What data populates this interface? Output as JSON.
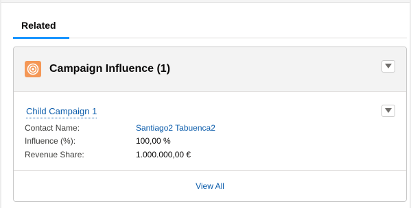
{
  "tabs": [
    {
      "label": "Related",
      "active": true
    }
  ],
  "card": {
    "icon": "campaign-target-icon",
    "icon_color": "#f49756",
    "title": "Campaign Influence (1)",
    "menu_icon": "chevron-down-icon"
  },
  "record": {
    "title": "Child Campaign 1",
    "fields": [
      {
        "label": "Contact Name:",
        "value": "Santiago2 Tabuenca2",
        "is_link": true
      },
      {
        "label": "Influence (%):",
        "value": "100,00 %",
        "is_link": false
      },
      {
        "label": "Revenue Share:",
        "value": "1.000.000,00 €",
        "is_link": false
      }
    ],
    "menu_icon": "chevron-down-icon"
  },
  "footer": {
    "view_all_label": "View All"
  },
  "colors": {
    "link": "#0b5cab",
    "tab_underline": "#1b96ff",
    "header_bg": "#f3f3f3"
  }
}
